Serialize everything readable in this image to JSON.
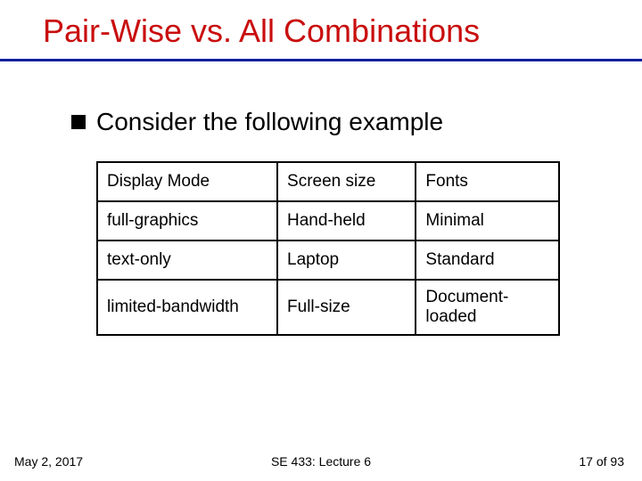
{
  "title": "Pair-Wise vs. All Combinations",
  "bullet": "Consider the following example",
  "chart_data": {
    "type": "table",
    "headers": [
      "Display Mode",
      "Screen size",
      "Fonts"
    ],
    "rows": [
      [
        "full-graphics",
        "Hand-held",
        "Minimal"
      ],
      [
        "text-only",
        "Laptop",
        "Standard"
      ],
      [
        "limited-bandwidth",
        "Full-size",
        "Document-loaded"
      ]
    ]
  },
  "footer": {
    "date": "May 2, 2017",
    "course": "SE 433: Lecture 6",
    "page": "17 of 93"
  }
}
